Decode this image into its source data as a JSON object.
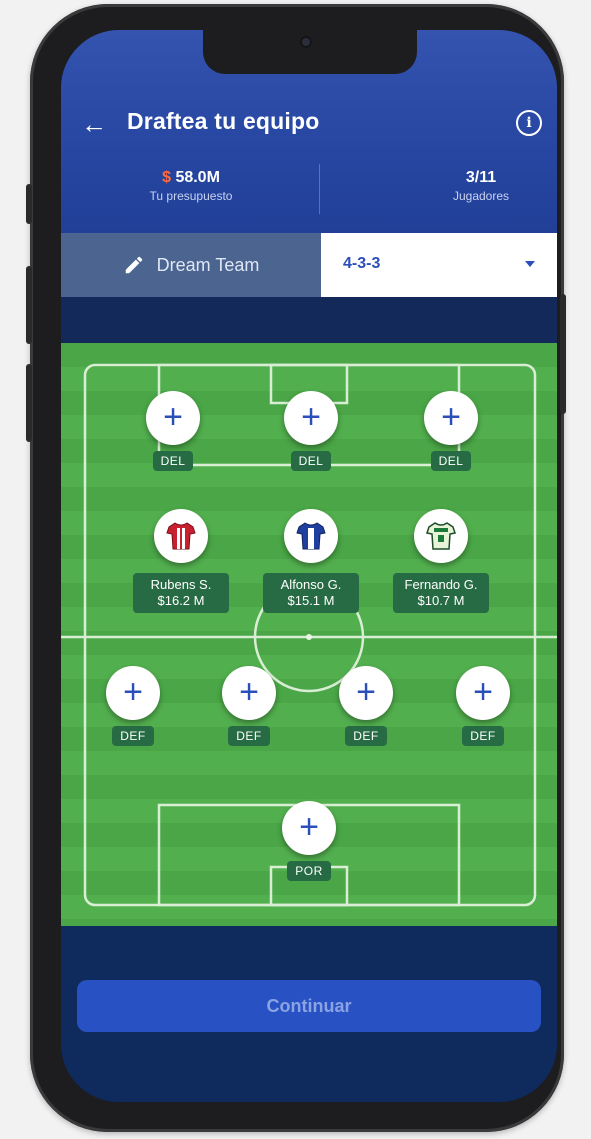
{
  "header": {
    "title": "Draftea tu equipo",
    "back_icon": "←",
    "info_icon": "i"
  },
  "stats": {
    "budget_currency": "$",
    "budget_value": "58.0M",
    "budget_label": "Tu presupuesto",
    "players_value": "3/11",
    "players_label": "Jugadores"
  },
  "team": {
    "name": "Dream Team",
    "formation": "4-3-3"
  },
  "pitch": {
    "forwards": [
      {
        "position": "DEL"
      },
      {
        "position": "DEL"
      },
      {
        "position": "DEL"
      }
    ],
    "midfielders": [
      {
        "name": "Rubens S.",
        "price": "$16.2 M",
        "shirt_colors": [
          "#c8202e",
          "#ffffff"
        ]
      },
      {
        "name": "Alfonso G.",
        "price": "$15.1 M",
        "shirt_colors": [
          "#1f3f9e",
          "#ffffff"
        ]
      },
      {
        "name": "Fernando G.",
        "price": "$10.7 M",
        "shirt_colors": [
          "#1b7a3a",
          "#e8f3d7"
        ]
      }
    ],
    "defenders": [
      {
        "position": "DEF"
      },
      {
        "position": "DEF"
      },
      {
        "position": "DEF"
      },
      {
        "position": "DEF"
      }
    ],
    "goalkeeper": {
      "position": "POR"
    },
    "add_symbol": "+"
  },
  "footer": {
    "continue_label": "Continuar"
  },
  "colors": {
    "accent": "#2b4fb8",
    "budget_dollar": "#ff6a3d",
    "badge": "#276b44",
    "pitch": "#4aa646"
  }
}
